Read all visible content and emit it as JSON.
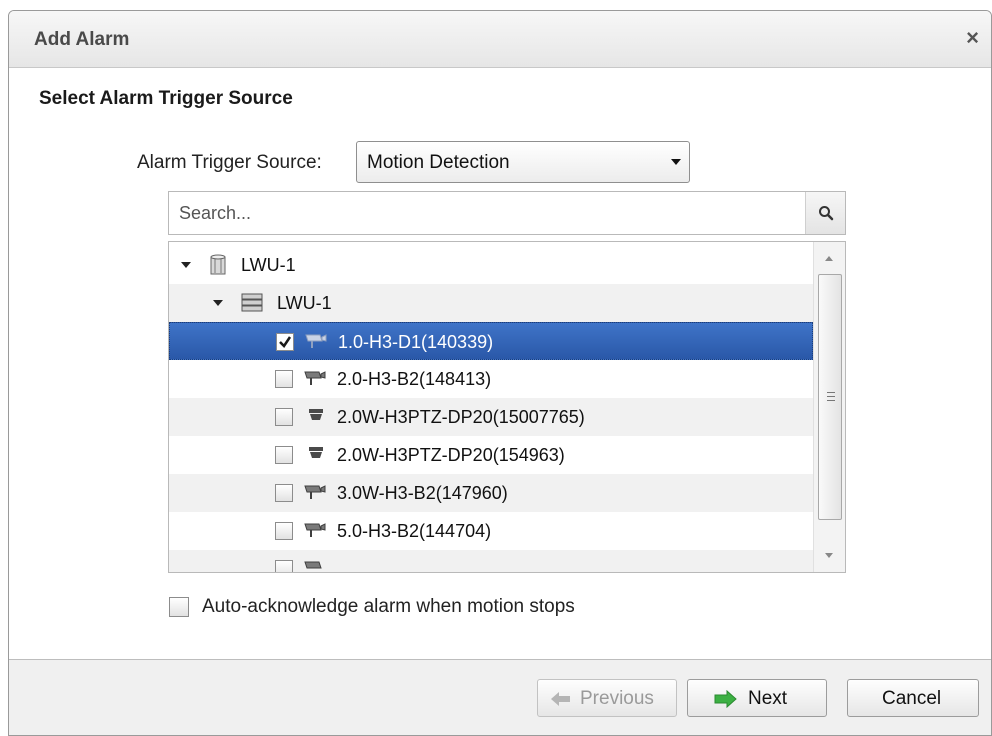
{
  "dialog": {
    "title": "Add Alarm",
    "close_glyph": "×"
  },
  "section_heading": "Select Alarm Trigger Source",
  "trigger_source": {
    "label": "Alarm Trigger Source:",
    "selected": "Motion Detection"
  },
  "search": {
    "placeholder": "Search..."
  },
  "tree": {
    "site": {
      "label": "LWU-1",
      "icon": "site-icon",
      "expanded": true
    },
    "server": {
      "label": "LWU-1",
      "icon": "server-icon",
      "expanded": true
    },
    "cameras": [
      {
        "label": "1.0-H3-D1(140339)",
        "checked": true,
        "selected": true,
        "icon": "bullet-camera-icon"
      },
      {
        "label": "2.0-H3-B2(148413)",
        "checked": false,
        "selected": false,
        "icon": "bullet-camera-icon"
      },
      {
        "label": "2.0W-H3PTZ-DP20(15007765)",
        "checked": false,
        "selected": false,
        "icon": "ptz-camera-icon"
      },
      {
        "label": "2.0W-H3PTZ-DP20(154963)",
        "checked": false,
        "selected": false,
        "icon": "ptz-camera-icon"
      },
      {
        "label": "3.0W-H3-B2(147960)",
        "checked": false,
        "selected": false,
        "icon": "bullet-camera-icon"
      },
      {
        "label": "5.0-H3-B2(144704)",
        "checked": false,
        "selected": false,
        "icon": "bullet-camera-icon"
      }
    ]
  },
  "auto_acknowledge": {
    "label": "Auto-acknowledge alarm when motion stops",
    "checked": false
  },
  "footer": {
    "previous_label": "Previous",
    "next_label": "Next",
    "cancel_label": "Cancel"
  },
  "colors": {
    "selection": "#2f5fb3",
    "next_arrow": "#3cb043",
    "previous_arrow_disabled": "#b5b5b5"
  }
}
